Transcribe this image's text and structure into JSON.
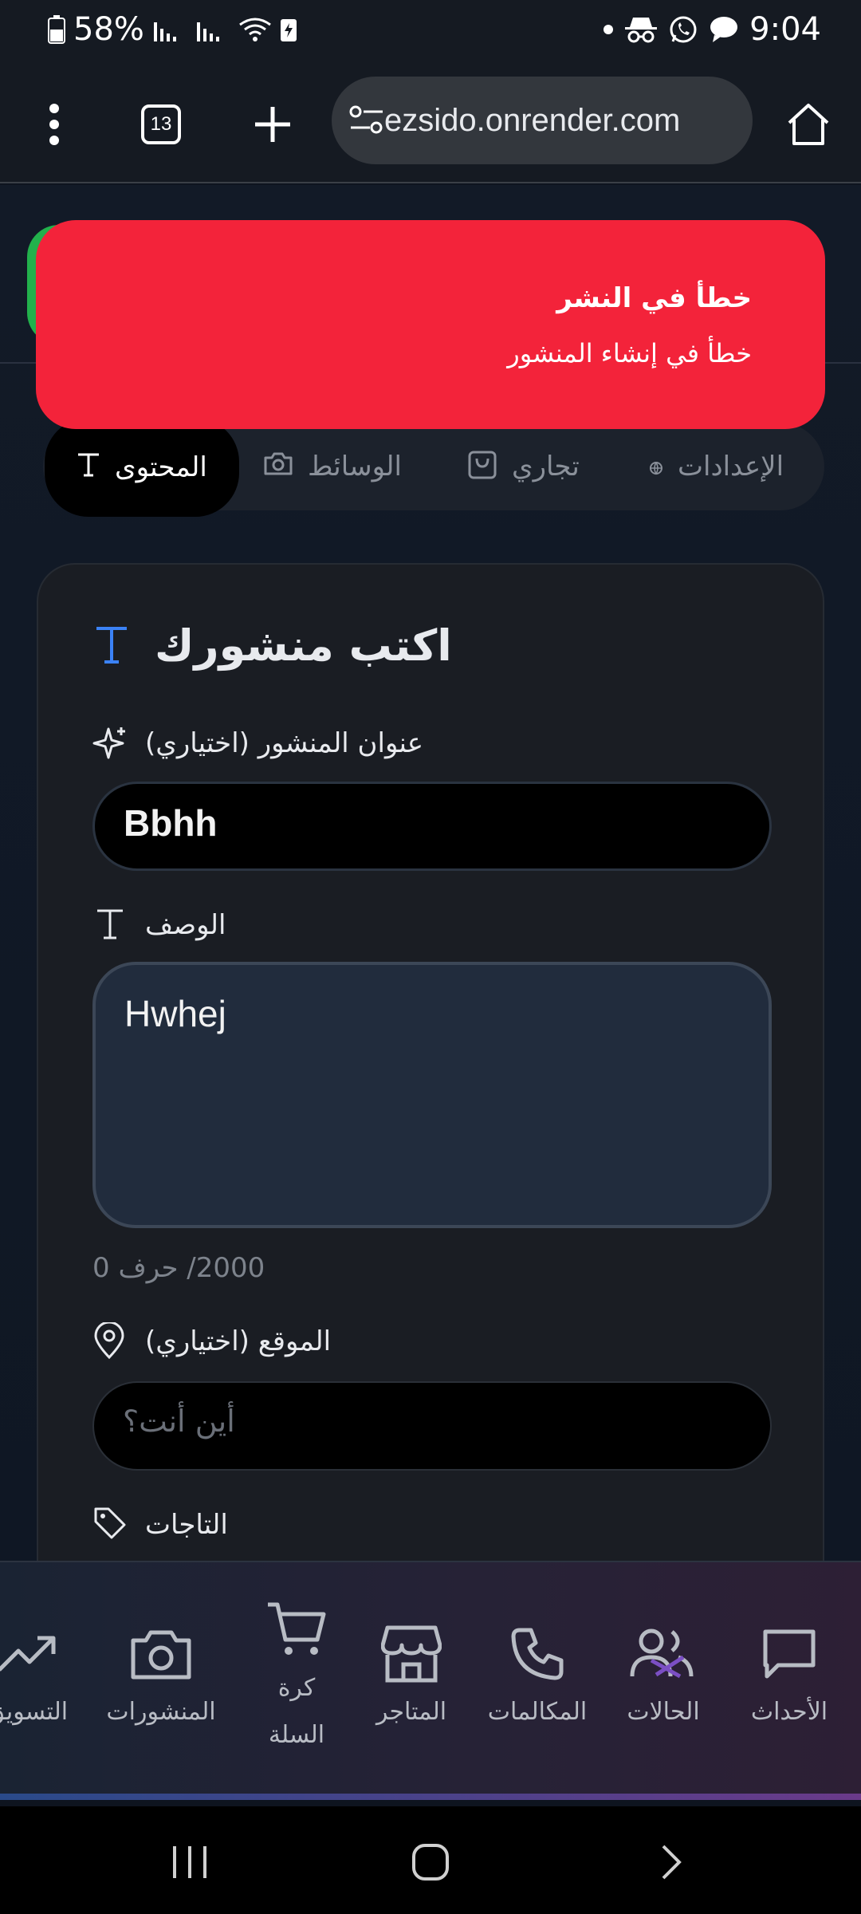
{
  "status_bar": {
    "battery_percent": "58%",
    "time": "9:04"
  },
  "browser": {
    "tab_count": "13",
    "url": "ezsido.onrender.com"
  },
  "toast": {
    "title": "خطأ في النشر",
    "message": "خطأ في إنشاء المنشور"
  },
  "tabs": [
    {
      "label": "المحتوى",
      "icon": "text-icon",
      "active": true
    },
    {
      "label": "الوسائط",
      "icon": "camera-icon",
      "active": false
    },
    {
      "label": "تجاري",
      "icon": "shopping-bag-icon",
      "active": false
    },
    {
      "label": "الإعدادات",
      "icon": "globe-icon",
      "active": false
    }
  ],
  "card": {
    "heading": "اكتب منشورك",
    "title_field": {
      "label": "عنوان المنشور (اختياري)",
      "value": "Bbhh"
    },
    "description_field": {
      "label": "الوصف",
      "value": "Hwhej"
    },
    "char_counter": "2000/ حرف 0",
    "location_field": {
      "label": "الموقع (اختياري)",
      "placeholder": "أين أنت؟"
    },
    "tags_label": "التاجات"
  },
  "bottom_nav": [
    {
      "label": "الأحداث",
      "icon": "chat-bubble-icon"
    },
    {
      "label": "الحالات",
      "icon": "users-icon"
    },
    {
      "label": "المكالمات",
      "icon": "phone-icon"
    },
    {
      "label": "المتاجر",
      "icon": "store-icon"
    },
    {
      "label_line1": "كرة",
      "label_line2": "السلة",
      "icon": "cart-icon"
    },
    {
      "label": "المنشورات",
      "icon": "camera-icon"
    },
    {
      "label": "التسويق",
      "icon": "trending-icon"
    }
  ],
  "colors": {
    "toast_bg": "#f3233a",
    "accent_blue": "#3b82f6",
    "card_bg": "#1a1d23"
  }
}
